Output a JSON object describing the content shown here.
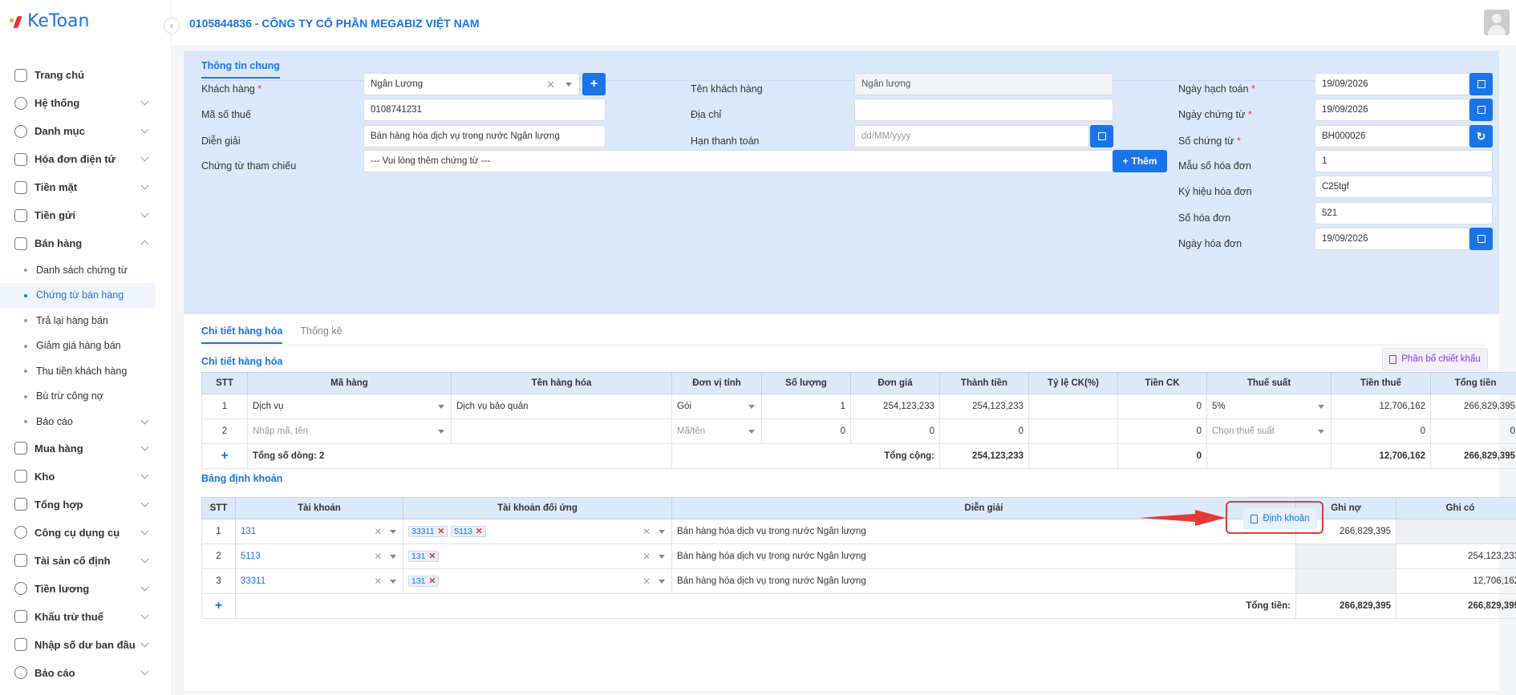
{
  "app": {
    "logo_text": "KeToan",
    "company": "0105844836 - CÔNG TY CỔ PHẦN MEGABIZ VIỆT NAM"
  },
  "sidebar": {
    "items": [
      {
        "label": "Trang chủ"
      },
      {
        "label": "Hệ thống"
      },
      {
        "label": "Danh mục"
      },
      {
        "label": "Hóa đơn điện tử"
      },
      {
        "label": "Tiền mặt"
      },
      {
        "label": "Tiền gửi"
      },
      {
        "label": "Bán hàng"
      },
      {
        "label": "Mua hàng"
      },
      {
        "label": "Kho"
      },
      {
        "label": "Tổng hợp"
      },
      {
        "label": "Công cụ dụng cụ"
      },
      {
        "label": "Tài sản cố định"
      },
      {
        "label": "Tiền lương"
      },
      {
        "label": "Khấu trừ thuế"
      },
      {
        "label": "Nhập số dư ban đầu"
      },
      {
        "label": "Báo cáo"
      }
    ],
    "sub_items": [
      {
        "label": "Danh sách chứng từ"
      },
      {
        "label": "Chứng từ bán hàng"
      },
      {
        "label": "Trả lại hàng bán"
      },
      {
        "label": "Giảm giá hàng bán"
      },
      {
        "label": "Thu tiền khách hàng"
      },
      {
        "label": "Bù trừ công nợ"
      },
      {
        "label": "Báo cáo"
      }
    ]
  },
  "general": {
    "tab": "Thông tin chung",
    "customer_label": "Khách hàng",
    "customer_value": "Ngân Lượng",
    "tax_label": "Mã số thuế",
    "tax_value": "0108741231",
    "desc_label": "Diễn giải",
    "desc_value": "Bán hàng hóa dịch vụ trong nước Ngân lượng",
    "ref_label": "Chứng từ tham chiếu",
    "ref_placeholder": "--- Vui lòng thêm chứng từ ---",
    "add_label": "Thêm",
    "cust_name_label": "Tên khách hàng",
    "cust_name_value": "Ngân lượng",
    "address_label": "Địa chỉ",
    "address_value": "",
    "due_label": "Hạn thanh toán",
    "due_placeholder": "dd/MM/yyyy",
    "post_date_label": "Ngày hạch toán",
    "post_date_value": "19/09/2026",
    "doc_date_label": "Ngày chứng từ",
    "doc_date_value": "19/09/2026",
    "doc_no_label": "Số chứng từ",
    "doc_no_value": "BH000026",
    "inv_form_label": "Mẫu số hóa đơn",
    "inv_form_value": "1",
    "inv_symbol_label": "Ký hiệu hóa đơn",
    "inv_symbol_value": "C25tgf",
    "inv_no_label": "Số hóa đơn",
    "inv_no_value": "521",
    "inv_date_label": "Ngày hóa đơn",
    "inv_date_value": "19/09/2026"
  },
  "detail": {
    "tabs": [
      "Chi tiết hàng hóa",
      "Thống kê"
    ],
    "section_title": "Chi tiết hàng hóa",
    "phanbo_label": "Phân bổ chiết khấu",
    "headers": [
      "STT",
      "Mã hàng",
      "Tên hàng hóa",
      "Đơn vị tính",
      "Số lượng",
      "Đơn giá",
      "Thành tiền",
      "Tỷ lệ CK(%)",
      "Tiền CK",
      "Thuế suất",
      "Tiền thuế",
      "Tổng tiền",
      "#"
    ],
    "rows": [
      {
        "stt": "1",
        "code": "Dịch vụ",
        "name": "Dịch vụ bảo quản",
        "unit": "Gói",
        "qty": "1",
        "price": "254,123,233",
        "amount": "254,123,233",
        "ck_rate": "",
        "ck": "0",
        "tax_rate": "5%",
        "tax": "12,706,162",
        "total": "266,829,395"
      },
      {
        "stt": "2",
        "code": "Nhập mã, tên",
        "name": "",
        "unit": "Mã/tên",
        "qty": "0",
        "price": "0",
        "amount": "0",
        "ck_rate": "",
        "ck": "0",
        "tax_rate": "Chọn thuế suất",
        "tax": "0",
        "total": "0"
      }
    ],
    "footer": {
      "count_label": "Tổng số dòng: 2",
      "sum_label": "Tổng cộng:",
      "amount": "254,123,233",
      "ck": "0",
      "tax": "12,706,162",
      "total": "266,829,395"
    }
  },
  "entries": {
    "section_title": "Bảng định khoản",
    "button_label": "Định khoản",
    "headers": [
      "STT",
      "Tài khoản",
      "Tài khoản đối ứng",
      "Diễn giải",
      "Ghi nợ",
      "Ghi có",
      "#"
    ],
    "rows": [
      {
        "stt": "1",
        "account": "131",
        "counter": [
          "33311",
          "5113"
        ],
        "desc": "Bán hàng hóa dịch vụ trong nước Ngân lượng",
        "debit": "266,829,395",
        "credit": ""
      },
      {
        "stt": "2",
        "account": "5113",
        "counter": [
          "131"
        ],
        "desc": "Bán hàng hóa dịch vụ trong nước Ngân lượng",
        "debit": "",
        "credit": "254,123,233"
      },
      {
        "stt": "3",
        "account": "33311",
        "counter": [
          "131"
        ],
        "desc": "Bán hàng hóa dịch vụ trong nước Ngân lượng",
        "debit": "",
        "credit": "12,706,162"
      }
    ],
    "footer": {
      "label": "Tổng tiền:",
      "debit": "266,829,395",
      "credit": "266,829,395"
    }
  },
  "colors": {
    "accent": "#1a73e8",
    "panel": "#dbe8fb",
    "danger": "#e53935"
  }
}
